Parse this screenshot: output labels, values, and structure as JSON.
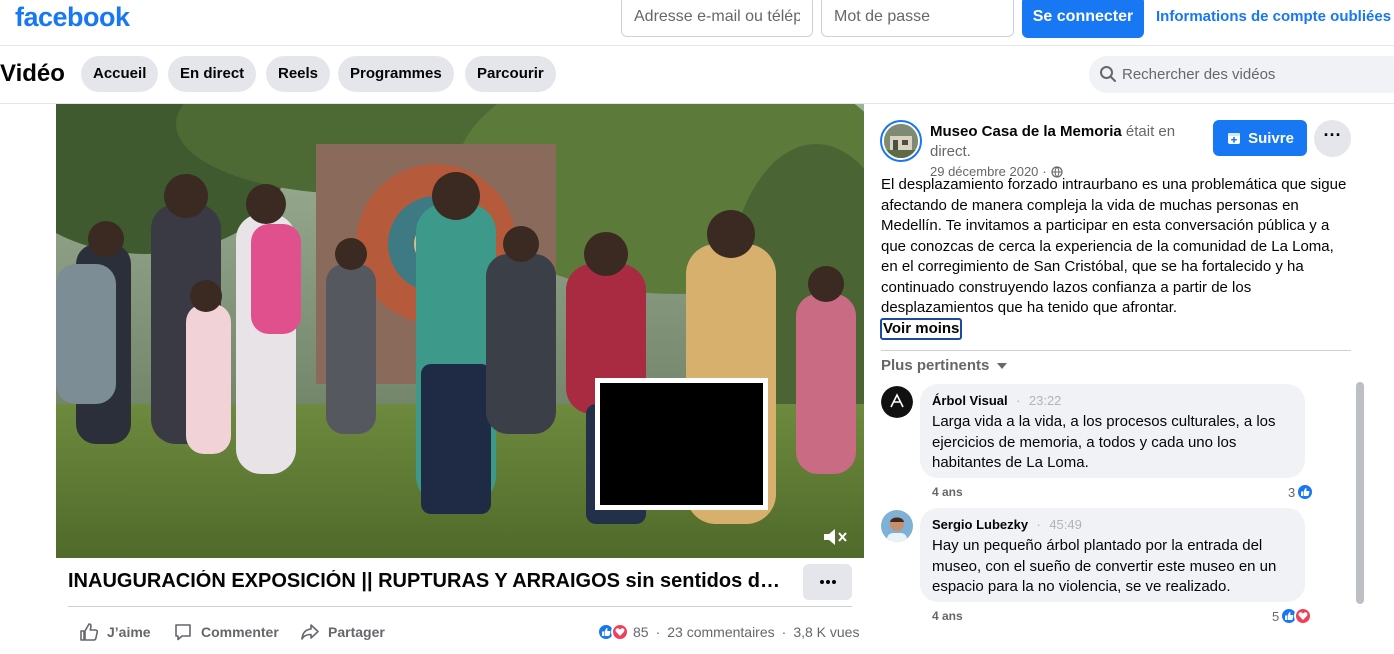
{
  "header": {
    "logo": "facebook",
    "email_placeholder": "Adresse e-mail ou téléphone",
    "password_placeholder": "Mot de passe",
    "login_label": "Se connecter",
    "forgot_label": "Informations de compte oubliées ?"
  },
  "video_nav": {
    "title": "Vidéo",
    "tabs": [
      "Accueil",
      "En direct",
      "Reels",
      "Programmes",
      "Parcourir"
    ],
    "search_placeholder": "Rechercher des vidéos"
  },
  "video": {
    "title": "INAUGURACIÓN EXPOSICIÓN || RUPTURAS Y ARRAIGOS sin sentidos de la violencia",
    "actions": {
      "like": "J’aime",
      "comment": "Commenter",
      "share": "Partager"
    },
    "reaction_count": "85",
    "comments_count": "23 commentaires",
    "views": "3,8 K vues",
    "separator": "·"
  },
  "post": {
    "page_name": "Museo Casa de la Memoria",
    "status": "était en direct.",
    "date": "29 décembre 2020",
    "date_sep": "·",
    "follow_label": "Suivre",
    "more_label": "···",
    "description": "El desplazamiento forzado intraurbano es una problemática que sigue afectando de manera compleja la vida de muchas personas en Medellín. Te invitamos a participar en esta conversación pública y a que conozcas de cerca la experiencia de la comunidad de La Loma, en el corregimiento de San Cristóbal, que se ha fortalecido y ha continuado construyendo lazos confianza a partir de los desplazamientos que ha tenido que afrontar.",
    "see_less": "Voir moins",
    "sort_label": "Plus pertinents"
  },
  "comments": [
    {
      "author": "Árbol Visual",
      "timestamp": "23:22",
      "dot": "·",
      "text": "Larga vida a la vida, a los procesos culturales, a los ejercicios de memoria, a todos y cada uno los habitantes de La Loma.",
      "age": "4 ans",
      "reactions": "3"
    },
    {
      "author": "Sergio Lubezky",
      "timestamp": "45:49",
      "dot": "·",
      "text": "Hay un pequeño árbol plantado por la entrada del museo, con el sueño de convertir este museo en un espacio para la no violencia, se ve realizado.",
      "age": "4 ans",
      "reactions": "5"
    }
  ],
  "colors": {
    "brand": "#1877f2",
    "love": "#f33e58",
    "secondary_text": "#65676b"
  }
}
